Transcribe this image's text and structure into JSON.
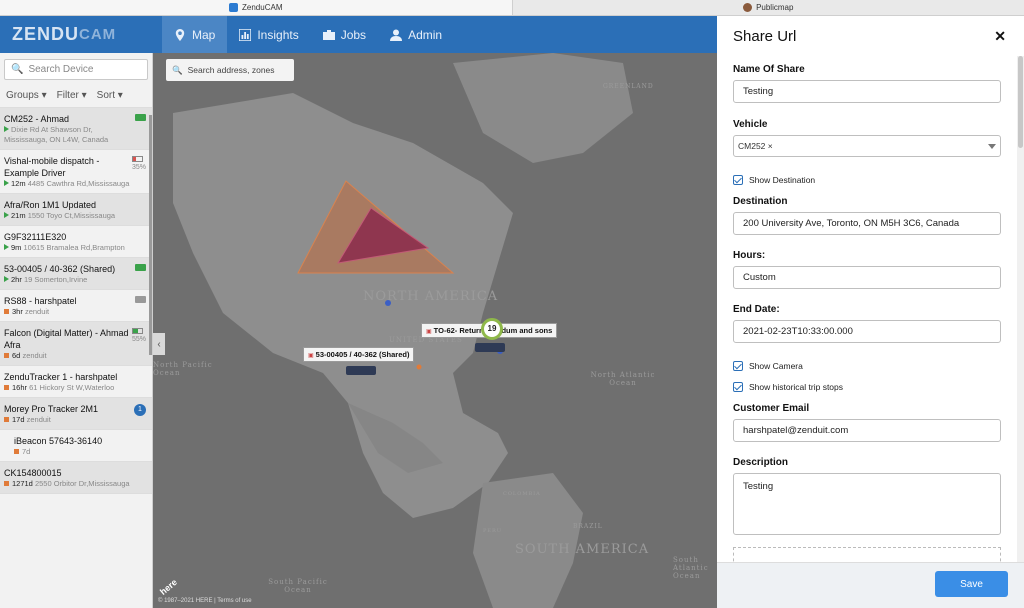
{
  "browser": {
    "tabs": [
      {
        "label": "ZenduCAM"
      },
      {
        "label": "Publicmap"
      }
    ]
  },
  "nav": {
    "logo_main": "ZENDU",
    "logo_sub": "CAM",
    "items": [
      {
        "label": "Map"
      },
      {
        "label": "Insights"
      },
      {
        "label": "Jobs"
      },
      {
        "label": "Admin"
      }
    ]
  },
  "sidebar": {
    "search_placeholder": "Search Device",
    "filters": [
      "Groups",
      "Filter",
      "Sort"
    ],
    "vehicles": [
      {
        "name": "CM252 - Ahmad",
        "time": "",
        "addr": "Dixie Rd At Shawson Dr, Mississauga, ON L4W, Canada",
        "status": ""
      },
      {
        "name": "Vishal-mobile dispatch - Example Driver",
        "time": "12m",
        "addr": "4485 Cawthra Rd,Mississauga",
        "status": "35%"
      },
      {
        "name": "Afra/Ron 1M1 Updated",
        "time": "21m",
        "addr": "1550 Toyo Ct,Mississauga",
        "status": ""
      },
      {
        "name": "G9F32111E320",
        "time": "9m",
        "addr": "10615 Bramalea Rd,Brampton",
        "status": ""
      },
      {
        "name": "53-00405 / 40-362 (Shared)",
        "time": "2hr",
        "addr": "19 Somerton,Irvine",
        "status": ""
      },
      {
        "name": "RS88 - harshpatel",
        "time": "3hr",
        "addr": "zenduit",
        "status": ""
      },
      {
        "name": "Falcon (Digital Matter) - Ahmad Afra",
        "time": "6d",
        "addr": "zenduit",
        "status": "55%"
      },
      {
        "name": "ZenduTracker 1 - harshpatel",
        "time": "16hr",
        "addr": "61 Hickory St W,Waterloo",
        "status": ""
      },
      {
        "name": "Morey Pro Tracker 2M1",
        "time": "17d",
        "addr": "zenduit",
        "status": "1"
      },
      {
        "name": "iBeacon 57643-36140",
        "time": "7d",
        "addr": "",
        "status": ""
      },
      {
        "name": "CK154800015",
        "time": "1271d",
        "addr": "2550 Orbitor Dr,Mississauga",
        "status": ""
      }
    ]
  },
  "map": {
    "search_placeholder": "Search address, zones",
    "labels": {
      "north_america": "NORTH AMERICA",
      "south_america": "SOUTH AMERICA",
      "united_states": "UNITED STATES",
      "north_pacific": "North Pacific Ocean",
      "north_atlantic": "North Atlantic Ocean",
      "south_pacific": "South Pacific Ocean",
      "south_atlantic": "South Atlantic Ocean",
      "greenland": "GREENLAND",
      "brazil": "BRAZIL",
      "colombia": "COLOMBIA",
      "peru": "PERU"
    },
    "vehicle_labels": [
      {
        "text": "53-00405 / 40-362 (Shared)"
      },
      {
        "text": "TO-62- Return Freedum and sons"
      }
    ],
    "cluster_count": "19",
    "copyright": "© 1987–2021 HERE | Terms of use",
    "here_logo": "here"
  },
  "share": {
    "title": "Share Url",
    "name_label": "Name Of Share",
    "name_value": "Testing",
    "vehicle_label": "Vehicle",
    "vehicle_chip": "CM252",
    "show_destination": "Show Destination",
    "destination_label": "Destination",
    "destination_value": "200 University Ave, Toronto, ON M5H 3C6, Canada",
    "hours_label": "Hours:",
    "hours_value": "Custom",
    "end_date_label": "End Date:",
    "end_date_value": "2021-02-23T10:33:00.000",
    "show_camera": "Show Camera",
    "show_trip_stops": "Show historical trip stops",
    "email_label": "Customer Email",
    "email_value": "harshpatel@zenduit.com",
    "description_label": "Description",
    "description_value": "Testing",
    "save_label": "Save"
  },
  "colors": {
    "nav_bg": "#2b6fb7",
    "nav_active": "#4b86c5",
    "save_btn": "#3a8ee6",
    "zone_outer": "#c06a3c",
    "zone_inner": "#8b2a4c"
  }
}
